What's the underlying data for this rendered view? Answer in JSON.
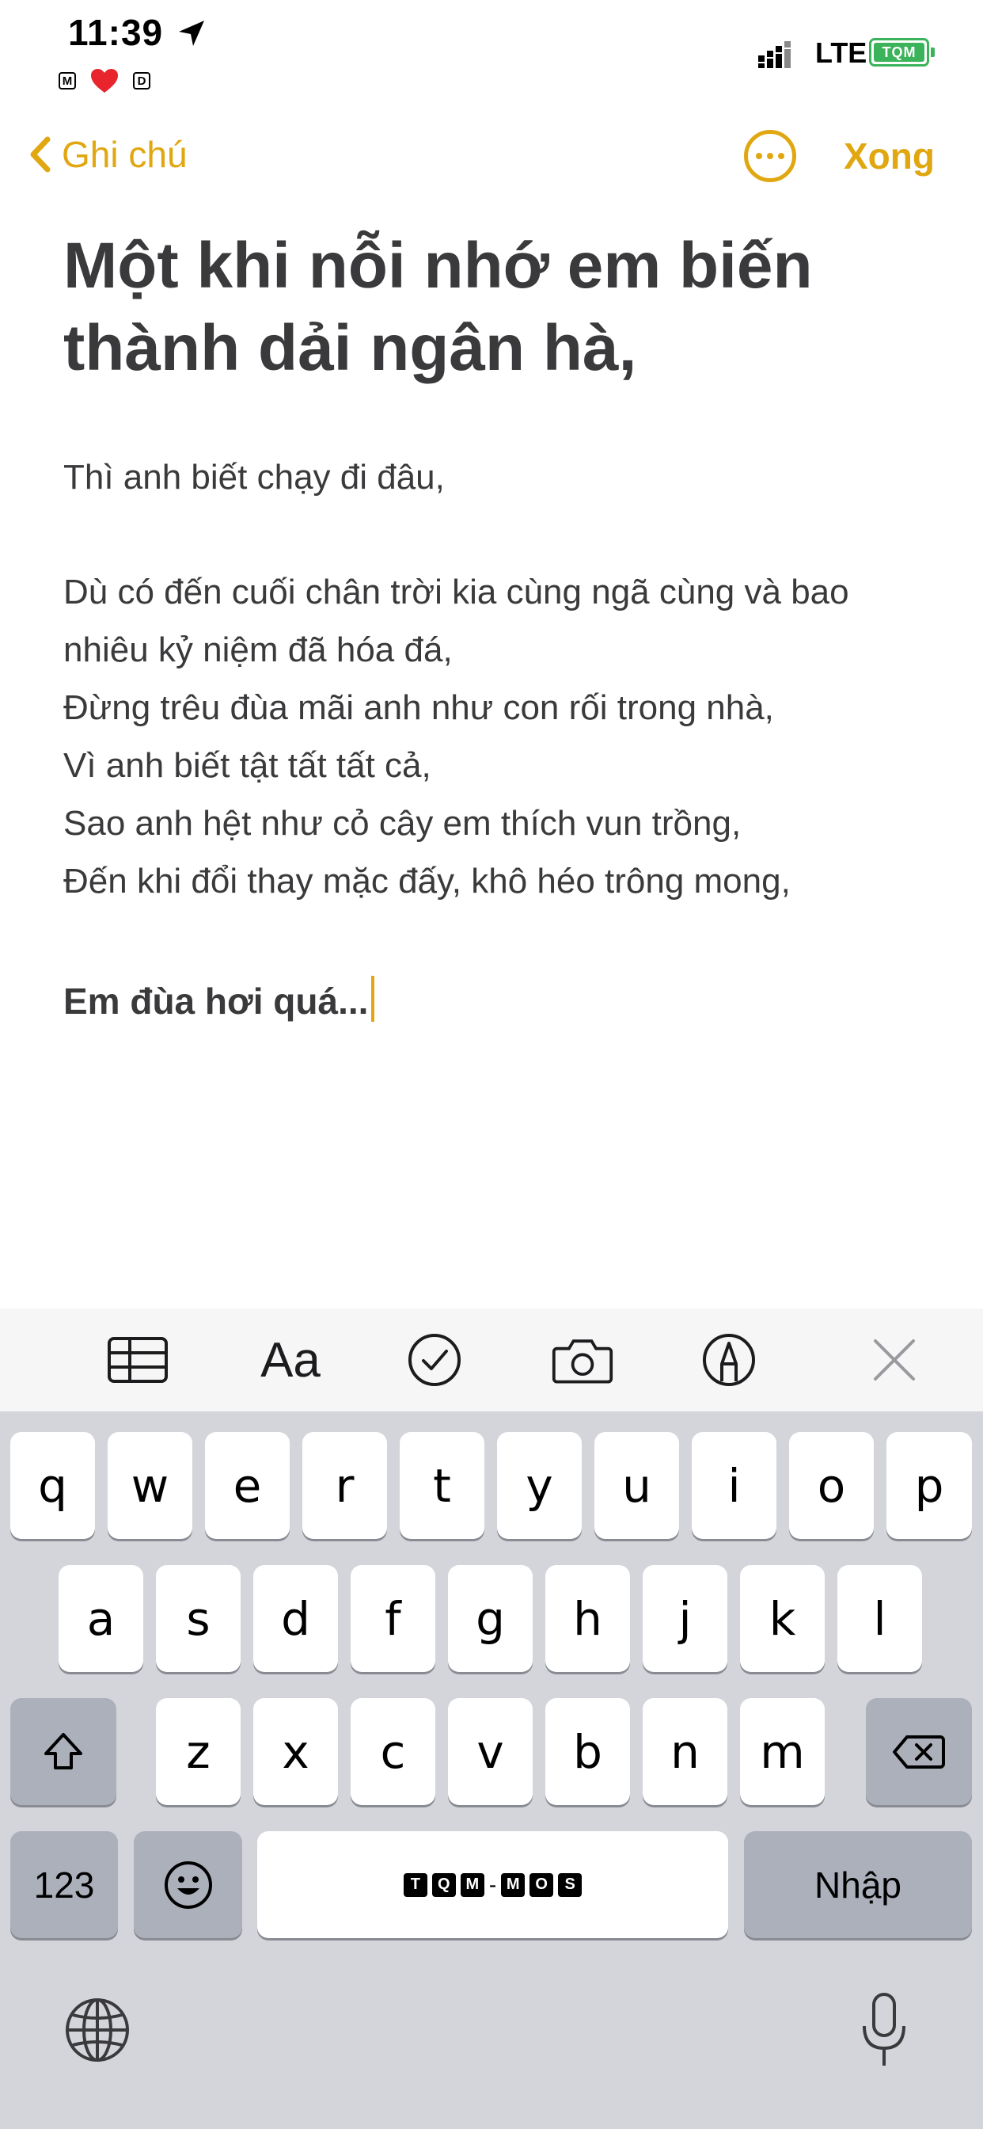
{
  "status_bar": {
    "time": "11:39",
    "badges": [
      "M",
      "D"
    ],
    "network": "LTE",
    "battery_label": "TQM"
  },
  "nav": {
    "back_label": "Ghi chú",
    "done_label": "Xong",
    "accent_color": "#e0a711"
  },
  "note": {
    "title": "Một khi nỗi nhớ em biến thành dải ngân hà,",
    "lines": [
      "Thì anh biết chạy đi đâu,",
      "",
      "Dù có đến cuối chân trời kia cùng ngã cùng và bao",
      "nhiêu kỷ niệm đã hóa đá,",
      "Đừng trêu đùa mãi anh như con rối trong nhà,",
      "Vì anh biết tật tất tất cả,",
      "Sao anh hệt như cỏ cây em thích vun trồng,",
      "Đến khi đổi thay mặc đấy, khô héo trông mong,",
      "",
      "Em đùa hơi quá..."
    ]
  },
  "toolbar": {
    "format_label": "Aa",
    "items": [
      "table-icon",
      "format-text",
      "checklist-icon",
      "camera-icon",
      "markup-icon",
      "close-icon"
    ]
  },
  "keyboard": {
    "row1": [
      "q",
      "w",
      "e",
      "r",
      "t",
      "y",
      "u",
      "i",
      "o",
      "p"
    ],
    "row2": [
      "a",
      "s",
      "d",
      "f",
      "g",
      "h",
      "j",
      "k",
      "l"
    ],
    "row3": [
      "z",
      "x",
      "c",
      "v",
      "b",
      "n",
      "m"
    ],
    "numbers_label": "123",
    "enter_label": "Nhập",
    "space_brand": [
      "T",
      "Q",
      "M",
      "-",
      "M",
      "O",
      "S"
    ]
  }
}
